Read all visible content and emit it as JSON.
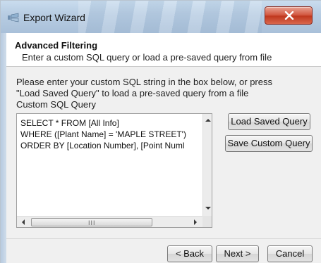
{
  "window": {
    "title": "Export Wizard",
    "icon": "wizard-icon",
    "close_icon": "close-icon"
  },
  "header": {
    "title": "Advanced Filtering",
    "subtitle": "Enter a custom SQL query or load a pre-saved query from file"
  },
  "body": {
    "instruction_line1": "Please enter your custom SQL string in the box below, or press",
    "instruction_line2": "\"Load Saved Query\" to load a pre-saved query from a file",
    "sql_label": "Custom SQL Query",
    "sql_lines": [
      "SELECT * FROM [All Info]",
      "WHERE ([Plant Name] = 'MAPLE STREET')",
      "ORDER BY [Location Number], [Point Numl"
    ]
  },
  "buttons": {
    "load_saved_query": "Load Saved Query",
    "save_custom_query": "Save Custom Query",
    "back": "< Back",
    "next": "Next >",
    "cancel": "Cancel"
  },
  "scrollbar": {
    "grip": "III"
  },
  "colors": {
    "titlebar": "#b8cde3",
    "close_button": "#c0391f",
    "dialog_bg": "#f0f0f0"
  }
}
